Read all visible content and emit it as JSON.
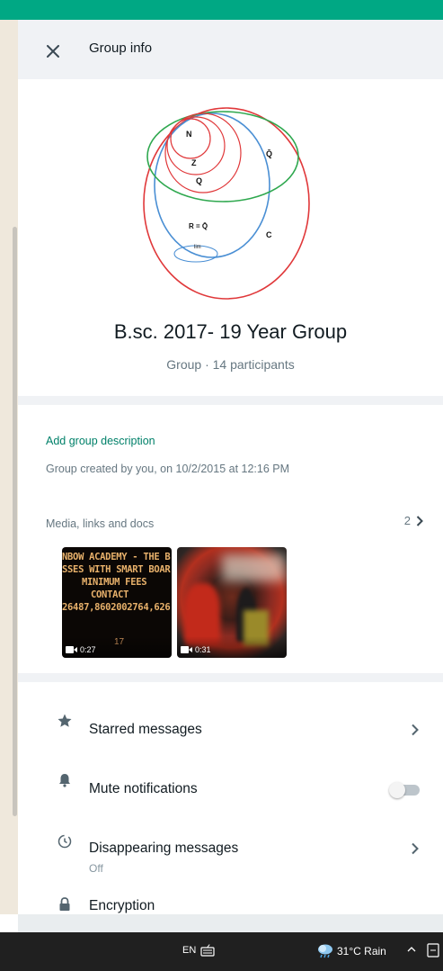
{
  "header": {
    "title": "Group info"
  },
  "group": {
    "name": "B.sc. 2017- 19 Year Group",
    "meta": "Group · 14 participants",
    "avatar_labels": {
      "n": "N",
      "z": "Z",
      "q": "Q",
      "q_bar": "Q̄",
      "r": "R = Q̄",
      "lim": "lim",
      "c": "C"
    }
  },
  "about": {
    "add_description": "Add group description",
    "created": "Group created by you, on 10/2/2015 at 12:16 PM"
  },
  "media": {
    "label": "Media, links and docs",
    "count": "2",
    "items": [
      {
        "text_lines": [
          "NBOW ACADEMY - THE B",
          "SSES WITH SMART BOAR",
          "MINIMUM FEES",
          "CONTACT",
          "26487,8602002764,626"
        ],
        "sub": "17",
        "duration": "0:27"
      },
      {
        "duration": "0:31"
      }
    ]
  },
  "actions": {
    "starred": "Starred messages",
    "mute": "Mute notifications",
    "mute_enabled": false,
    "disappearing": "Disappearing messages",
    "disappearing_value": "Off",
    "encryption": "Encryption"
  },
  "taskbar": {
    "language": "EN",
    "weather": "31°C  Rain"
  },
  "colors": {
    "accent": "#00a884",
    "link": "#008069",
    "secondary_text": "#667781",
    "panel_bg": "#f0f2f5",
    "taskbar_bg": "#202020"
  },
  "icons": {
    "close": "close-icon",
    "star": "star-icon",
    "bell": "bell-icon",
    "timer": "timer-icon",
    "lock": "lock-icon",
    "chevron": "chevron-right-icon",
    "video": "video-icon",
    "weather": "cloud-rain-icon"
  }
}
